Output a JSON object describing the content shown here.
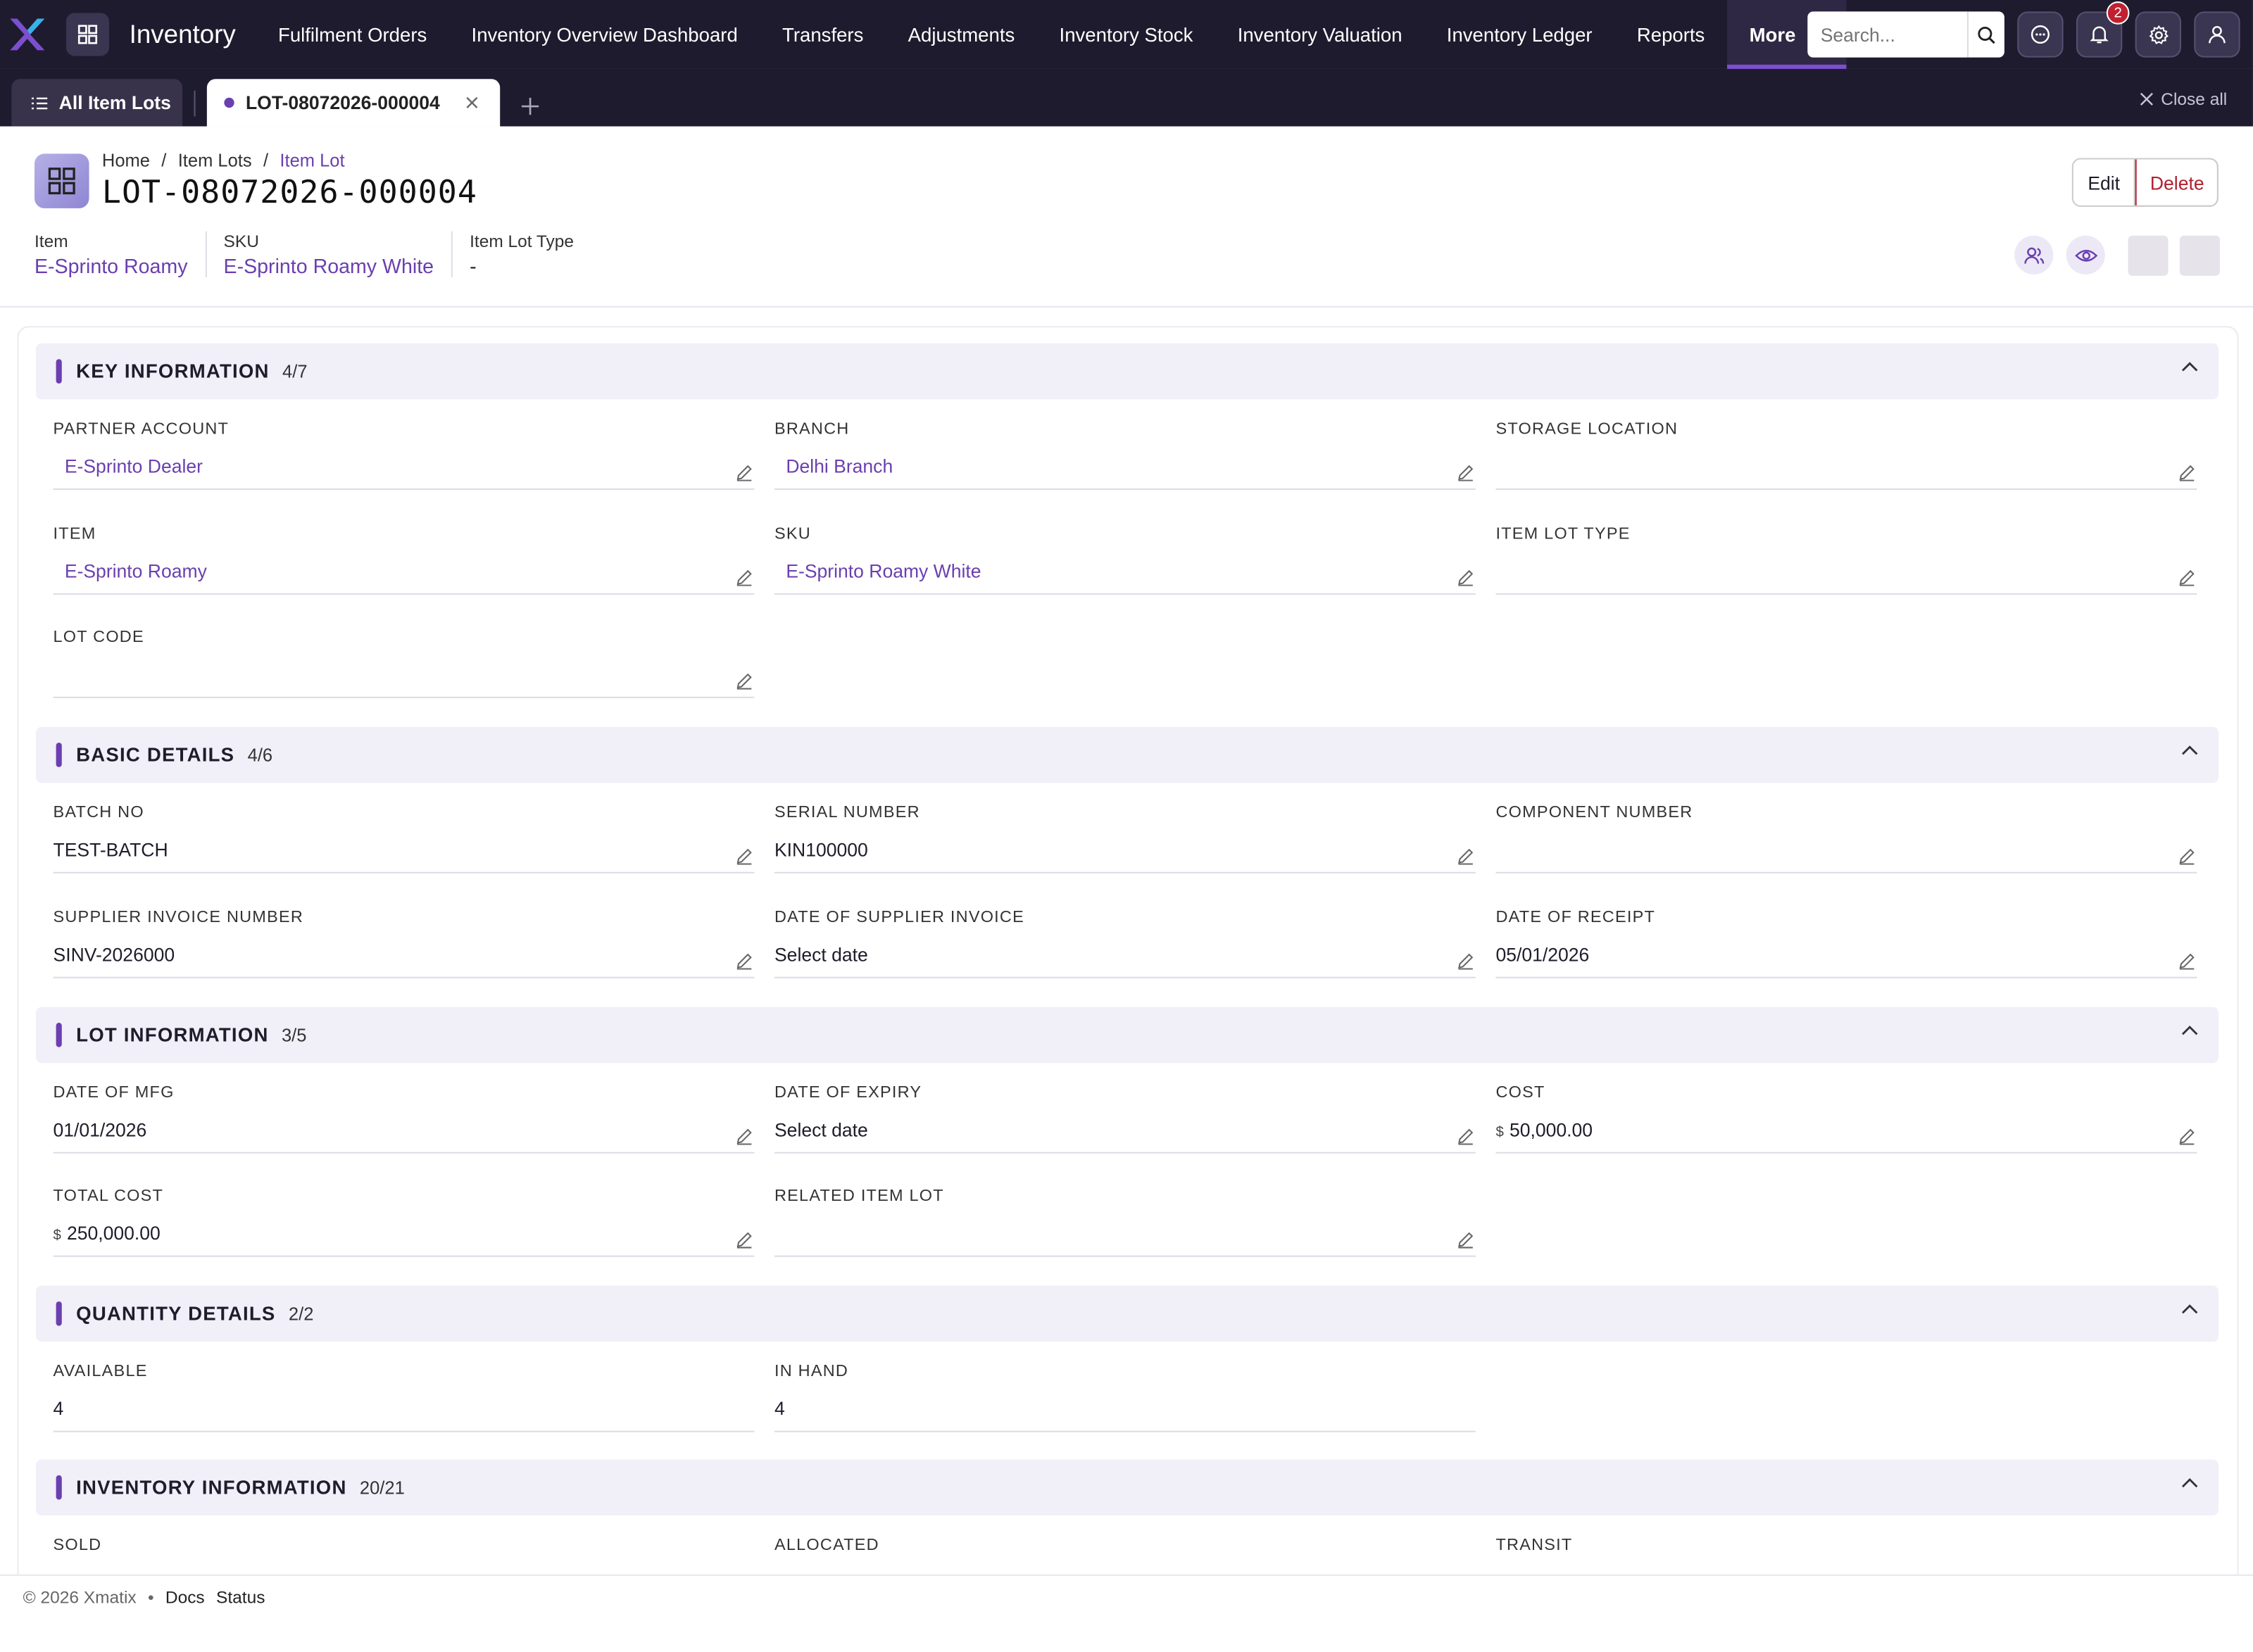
{
  "app": {
    "name": "Inventory"
  },
  "nav": {
    "items": [
      "Fulfilment Orders",
      "Inventory Overview Dashboard",
      "Transfers",
      "Adjustments",
      "Inventory Stock",
      "Inventory Valuation",
      "Inventory Ledger",
      "Reports"
    ],
    "more_label": "More",
    "search_placeholder": "Search...",
    "notification_count": "2"
  },
  "tabs": {
    "list_label": "All Item Lots",
    "active_label": "LOT-08072026-000004",
    "close_all": "Close all"
  },
  "header": {
    "breadcrumb": [
      "Home",
      "Item Lots",
      "Item Lot"
    ],
    "title": "LOT-08072026-000004",
    "edit_label": "Edit",
    "delete_label": "Delete",
    "meta": [
      {
        "label": "Item",
        "value": "E-Sprinto Roamy"
      },
      {
        "label": "SKU",
        "value": "E-Sprinto Roamy White"
      },
      {
        "label": "Item Lot Type",
        "value": "-"
      }
    ]
  },
  "sections": {
    "key": {
      "title": "KEY INFORMATION",
      "count": "4/7",
      "fields": [
        {
          "label": "PARTNER ACCOUNT",
          "value": "E-Sprinto Dealer"
        },
        {
          "label": "BRANCH",
          "value": "Delhi Branch"
        },
        {
          "label": "STORAGE LOCATION",
          "value": ""
        },
        {
          "label": "ITEM",
          "value": "E-Sprinto Roamy"
        },
        {
          "label": "SKU",
          "value": "E-Sprinto Roamy White"
        },
        {
          "label": "ITEM LOT TYPE",
          "value": ""
        },
        {
          "label": "LOT CODE",
          "value": ""
        }
      ]
    },
    "basic": {
      "title": "BASIC DETAILS",
      "count": "4/6",
      "fields": [
        {
          "label": "BATCH NO",
          "value": "TEST-BATCH"
        },
        {
          "label": "SERIAL NUMBER",
          "value": "KIN100000"
        },
        {
          "label": "COMPONENT NUMBER",
          "value": ""
        },
        {
          "label": "SUPPLIER INVOICE NUMBER",
          "value": "SINV-2026000"
        },
        {
          "label": "DATE OF SUPPLIER INVOICE",
          "value": "Select date"
        },
        {
          "label": "DATE OF RECEIPT",
          "value": "05/01/2026"
        }
      ]
    },
    "lot": {
      "title": "LOT INFORMATION",
      "count": "3/5",
      "fields": [
        {
          "label": "DATE OF MFG",
          "value": "01/01/2026"
        },
        {
          "label": "DATE OF EXPIRY",
          "value": "Select date"
        },
        {
          "label": "COST",
          "currency": "$",
          "value": "50,000.00"
        },
        {
          "label": "TOTAL COST",
          "currency": "$",
          "value": "250,000.00"
        },
        {
          "label": "RELATED ITEM LOT",
          "value": ""
        }
      ]
    },
    "qty": {
      "title": "QUANTITY DETAILS",
      "count": "2/2",
      "fields": [
        {
          "label": "AVAILABLE",
          "value": "4"
        },
        {
          "label": "IN HAND",
          "value": "4"
        }
      ]
    },
    "inv": {
      "title": "INVENTORY INFORMATION",
      "count": "20/21",
      "fields": [
        {
          "label": "SOLD",
          "value": ""
        },
        {
          "label": "ALLOCATED",
          "value": ""
        },
        {
          "label": "TRANSIT",
          "value": ""
        }
      ]
    }
  },
  "footer": {
    "copyright": "© 2026 Xmatix",
    "separator": "•",
    "docs": "Docs",
    "status": "Status"
  },
  "colors": {
    "accent": "#6a3fb0",
    "nav_bg": "#1f1b2e",
    "danger": "#b02030"
  }
}
